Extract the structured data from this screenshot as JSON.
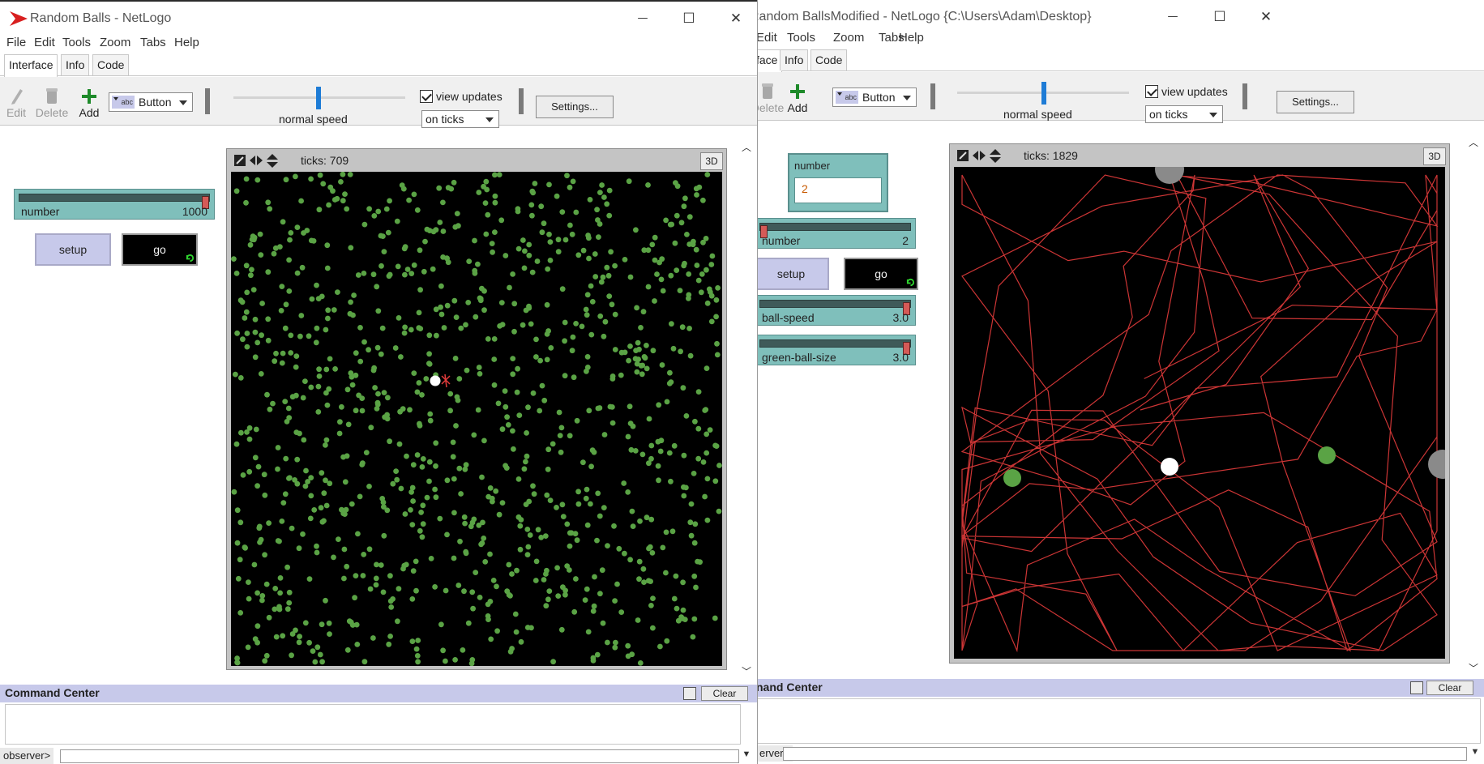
{
  "colors": {
    "slider_bg": "#7fbfbb",
    "slider_thumb": "#d55a57",
    "button_bg": "#c7c9ea",
    "command_header_bg": "#c7c9ea",
    "turtle_green": "#5aa345",
    "pen_red": "#e23b3b",
    "speed_thumb": "#1e7cd6"
  },
  "windowA": {
    "title": "Random Balls - NetLogo",
    "controls": {
      "minimize": "—",
      "maximize": "☐",
      "close": "✕"
    },
    "menu": [
      "File",
      "Edit",
      "Tools",
      "Zoom",
      "Tabs",
      "Help"
    ],
    "tabs": [
      "Interface",
      "Info",
      "Code"
    ],
    "toolbar": {
      "edit": "Edit",
      "delete": "Delete",
      "add": "Add",
      "widget_type": "Button",
      "speed_label": "normal speed",
      "view_updates": "view updates",
      "update_mode": "on ticks",
      "settings": "Settings..."
    },
    "slider_number": {
      "name": "number",
      "value": "1000",
      "fraction": 1.0
    },
    "setup_label": "setup",
    "go_label": "go",
    "ticks": "ticks: 709",
    "btn3d": "3D",
    "command_center": {
      "title": "Command Center",
      "clear": "Clear",
      "observer": "observer>"
    }
  },
  "windowB": {
    "title": "Random BallsModified - NetLogo {C:\\Users\\Adam\\Desktop}",
    "controls": {
      "minimize": "—",
      "maximize": "☐",
      "close": "✕"
    },
    "menu": [
      "Edit",
      "Tools",
      "Zoom",
      "Tabs",
      "Help"
    ],
    "tabs": [
      "face",
      "Info",
      "Code"
    ],
    "toolbar": {
      "delete": "Delete",
      "add": "Add",
      "widget_type": "Button",
      "speed_label": "normal speed",
      "view_updates": "view updates",
      "update_mode": "on ticks",
      "settings": "Settings..."
    },
    "monitor_number": {
      "name": "number",
      "value": "2"
    },
    "slider_number": {
      "name": "number",
      "value": "2",
      "fraction": 0.0
    },
    "setup_label": "setup",
    "go_label": "go",
    "slider_ball_speed": {
      "name": "ball-speed",
      "value": "3.0",
      "fraction": 1.0
    },
    "slider_green_ball_size": {
      "name": "green-ball-size",
      "value": "3.0",
      "fraction": 1.0
    },
    "ticks": "ticks: 1829",
    "btn3d": "3D",
    "command_center": {
      "title": "nand Center",
      "clear": "Clear",
      "observer": "erver>"
    }
  }
}
